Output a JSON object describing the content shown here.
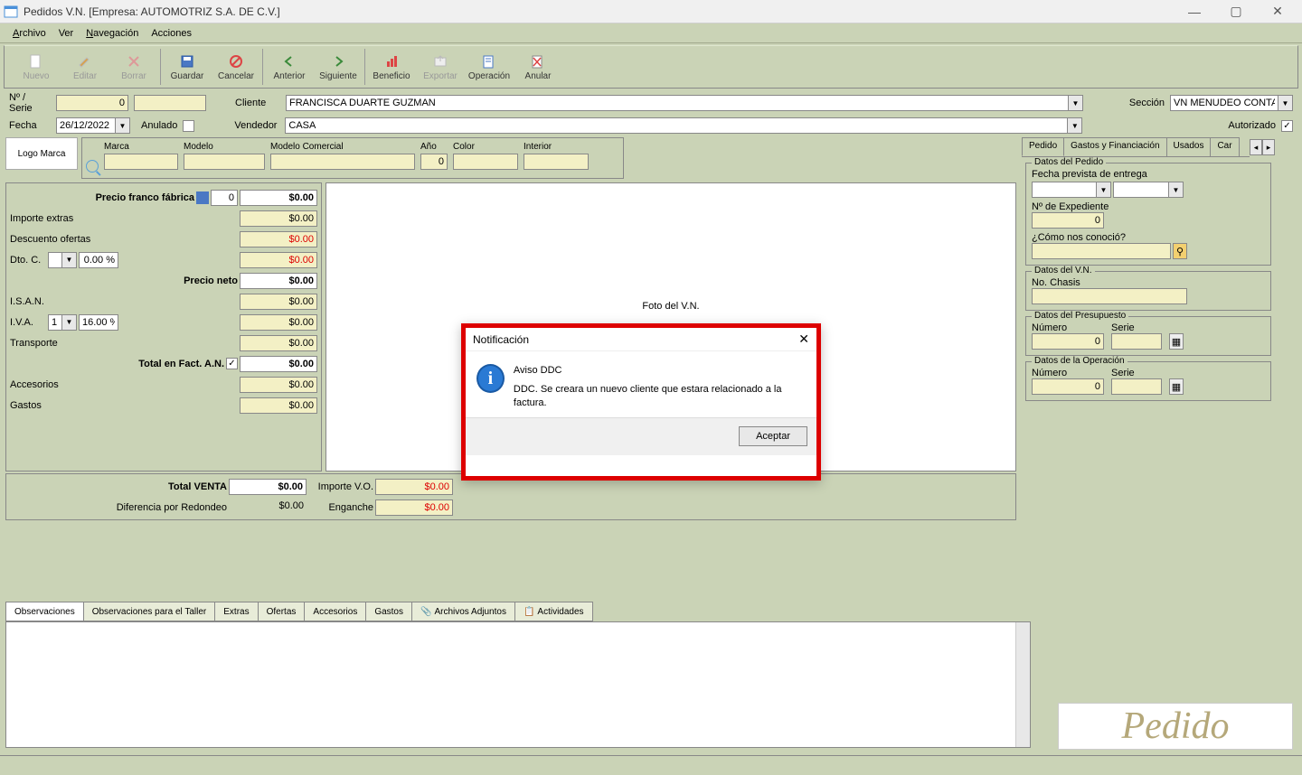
{
  "window": {
    "title": "Pedidos V.N. [Empresa: AUTOMOTRIZ S.A. DE C.V.]"
  },
  "menu": {
    "archivo": "Archivo",
    "ver": "Ver",
    "navegacion": "Navegación",
    "acciones": "Acciones"
  },
  "toolbar": {
    "nuevo": "Nuevo",
    "editar": "Editar",
    "borrar": "Borrar",
    "guardar": "Guardar",
    "cancelar": "Cancelar",
    "anterior": "Anterior",
    "siguiente": "Siguiente",
    "beneficio": "Beneficio",
    "exportar": "Exportar",
    "operacion": "Operación",
    "anular": "Anular"
  },
  "header": {
    "nserie_lbl": "Nº / Serie",
    "nserie_val": "0",
    "nserie_serie": "",
    "fecha_lbl": "Fecha",
    "fecha_val": "26/12/2022",
    "anulado_lbl": "Anulado",
    "cliente_lbl": "Cliente",
    "cliente_val": "FRANCISCA DUARTE GUZMAN",
    "vendedor_lbl": "Vendedor",
    "vendedor_val": "CASA",
    "seccion_lbl": "Sección",
    "seccion_val": "VN MENUDEO CONTA ···",
    "autorizado_lbl": "Autorizado"
  },
  "vehicle": {
    "logo_lbl": "Logo Marca",
    "marca_lbl": "Marca",
    "modelo_lbl": "Modelo",
    "modelocom_lbl": "Modelo Comercial",
    "ano_lbl": "Año",
    "ano_val": "0",
    "color_lbl": "Color",
    "interior_lbl": "Interior",
    "foto_lbl": "Foto del V.N."
  },
  "prices": {
    "franco_lbl": "Precio franco fábrica",
    "franco_q": "0",
    "franco_v": "$0.00",
    "extras_lbl": "Importe extras",
    "extras_v": "$0.00",
    "descof_lbl": "Descuento ofertas",
    "descof_v": "$0.00",
    "dtoc_lbl": "Dto. C.",
    "dtoc_pct": "0.00 %",
    "dtoc_v": "$0.00",
    "neto_lbl": "Precio neto",
    "neto_v": "$0.00",
    "isan_lbl": "I.S.A.N.",
    "isan_v": "$0.00",
    "iva_lbl": "I.V.A.",
    "iva_sel": "1",
    "iva_pct": "16.00 %",
    "iva_v": "$0.00",
    "transp_lbl": "Transporte",
    "transp_v": "$0.00",
    "totfact_lbl": "Total en Fact. A.N.",
    "totfact_v": "$0.00",
    "acc_lbl": "Accesorios",
    "acc_v": "$0.00",
    "gastos_lbl": "Gastos",
    "gastos_v": "$0.00",
    "totventa_lbl": "Total VENTA",
    "totventa_v": "$0.00",
    "difred_lbl": "Diferencia por Redondeo",
    "difred_v": "$0.00",
    "impvo_lbl": "Importe V.O.",
    "impvo_v": "$0.00",
    "eng_lbl": "Enganche",
    "eng_v": "$0.00"
  },
  "rtabs": {
    "pedido": "Pedido",
    "gastos": "Gastos y Financiación",
    "usados": "Usados",
    "car": "Car"
  },
  "rpanel": {
    "datosped_title": "Datos del Pedido",
    "fechaprev_lbl": "Fecha prevista de entrega",
    "nexp_lbl": "Nº de Expediente",
    "nexp_v": "0",
    "conocio_lbl": "¿Cómo nos conoció?",
    "datosvn_title": "Datos del V.N.",
    "chasis_lbl": "No. Chasis",
    "datospres_title": "Datos del Presupuesto",
    "numero_lbl": "Número",
    "serie_lbl": "Serie",
    "numero_v": "0",
    "datosop_title": "Datos de la Operación",
    "opnum_v": "0"
  },
  "btabs": {
    "obs": "Observaciones",
    "obst": "Observaciones para el Taller",
    "extras": "Extras",
    "ofertas": "Ofertas",
    "acc": "Accesorios",
    "gastos": "Gastos",
    "adj": "Archivos Adjuntos",
    "act": "Actividades"
  },
  "watermark": "Pedido",
  "modal": {
    "title": "Notificación",
    "heading": "Aviso DDC",
    "body": "DDC. Se creara un nuevo cliente que estara relacionado a la factura.",
    "ok": "Aceptar"
  }
}
